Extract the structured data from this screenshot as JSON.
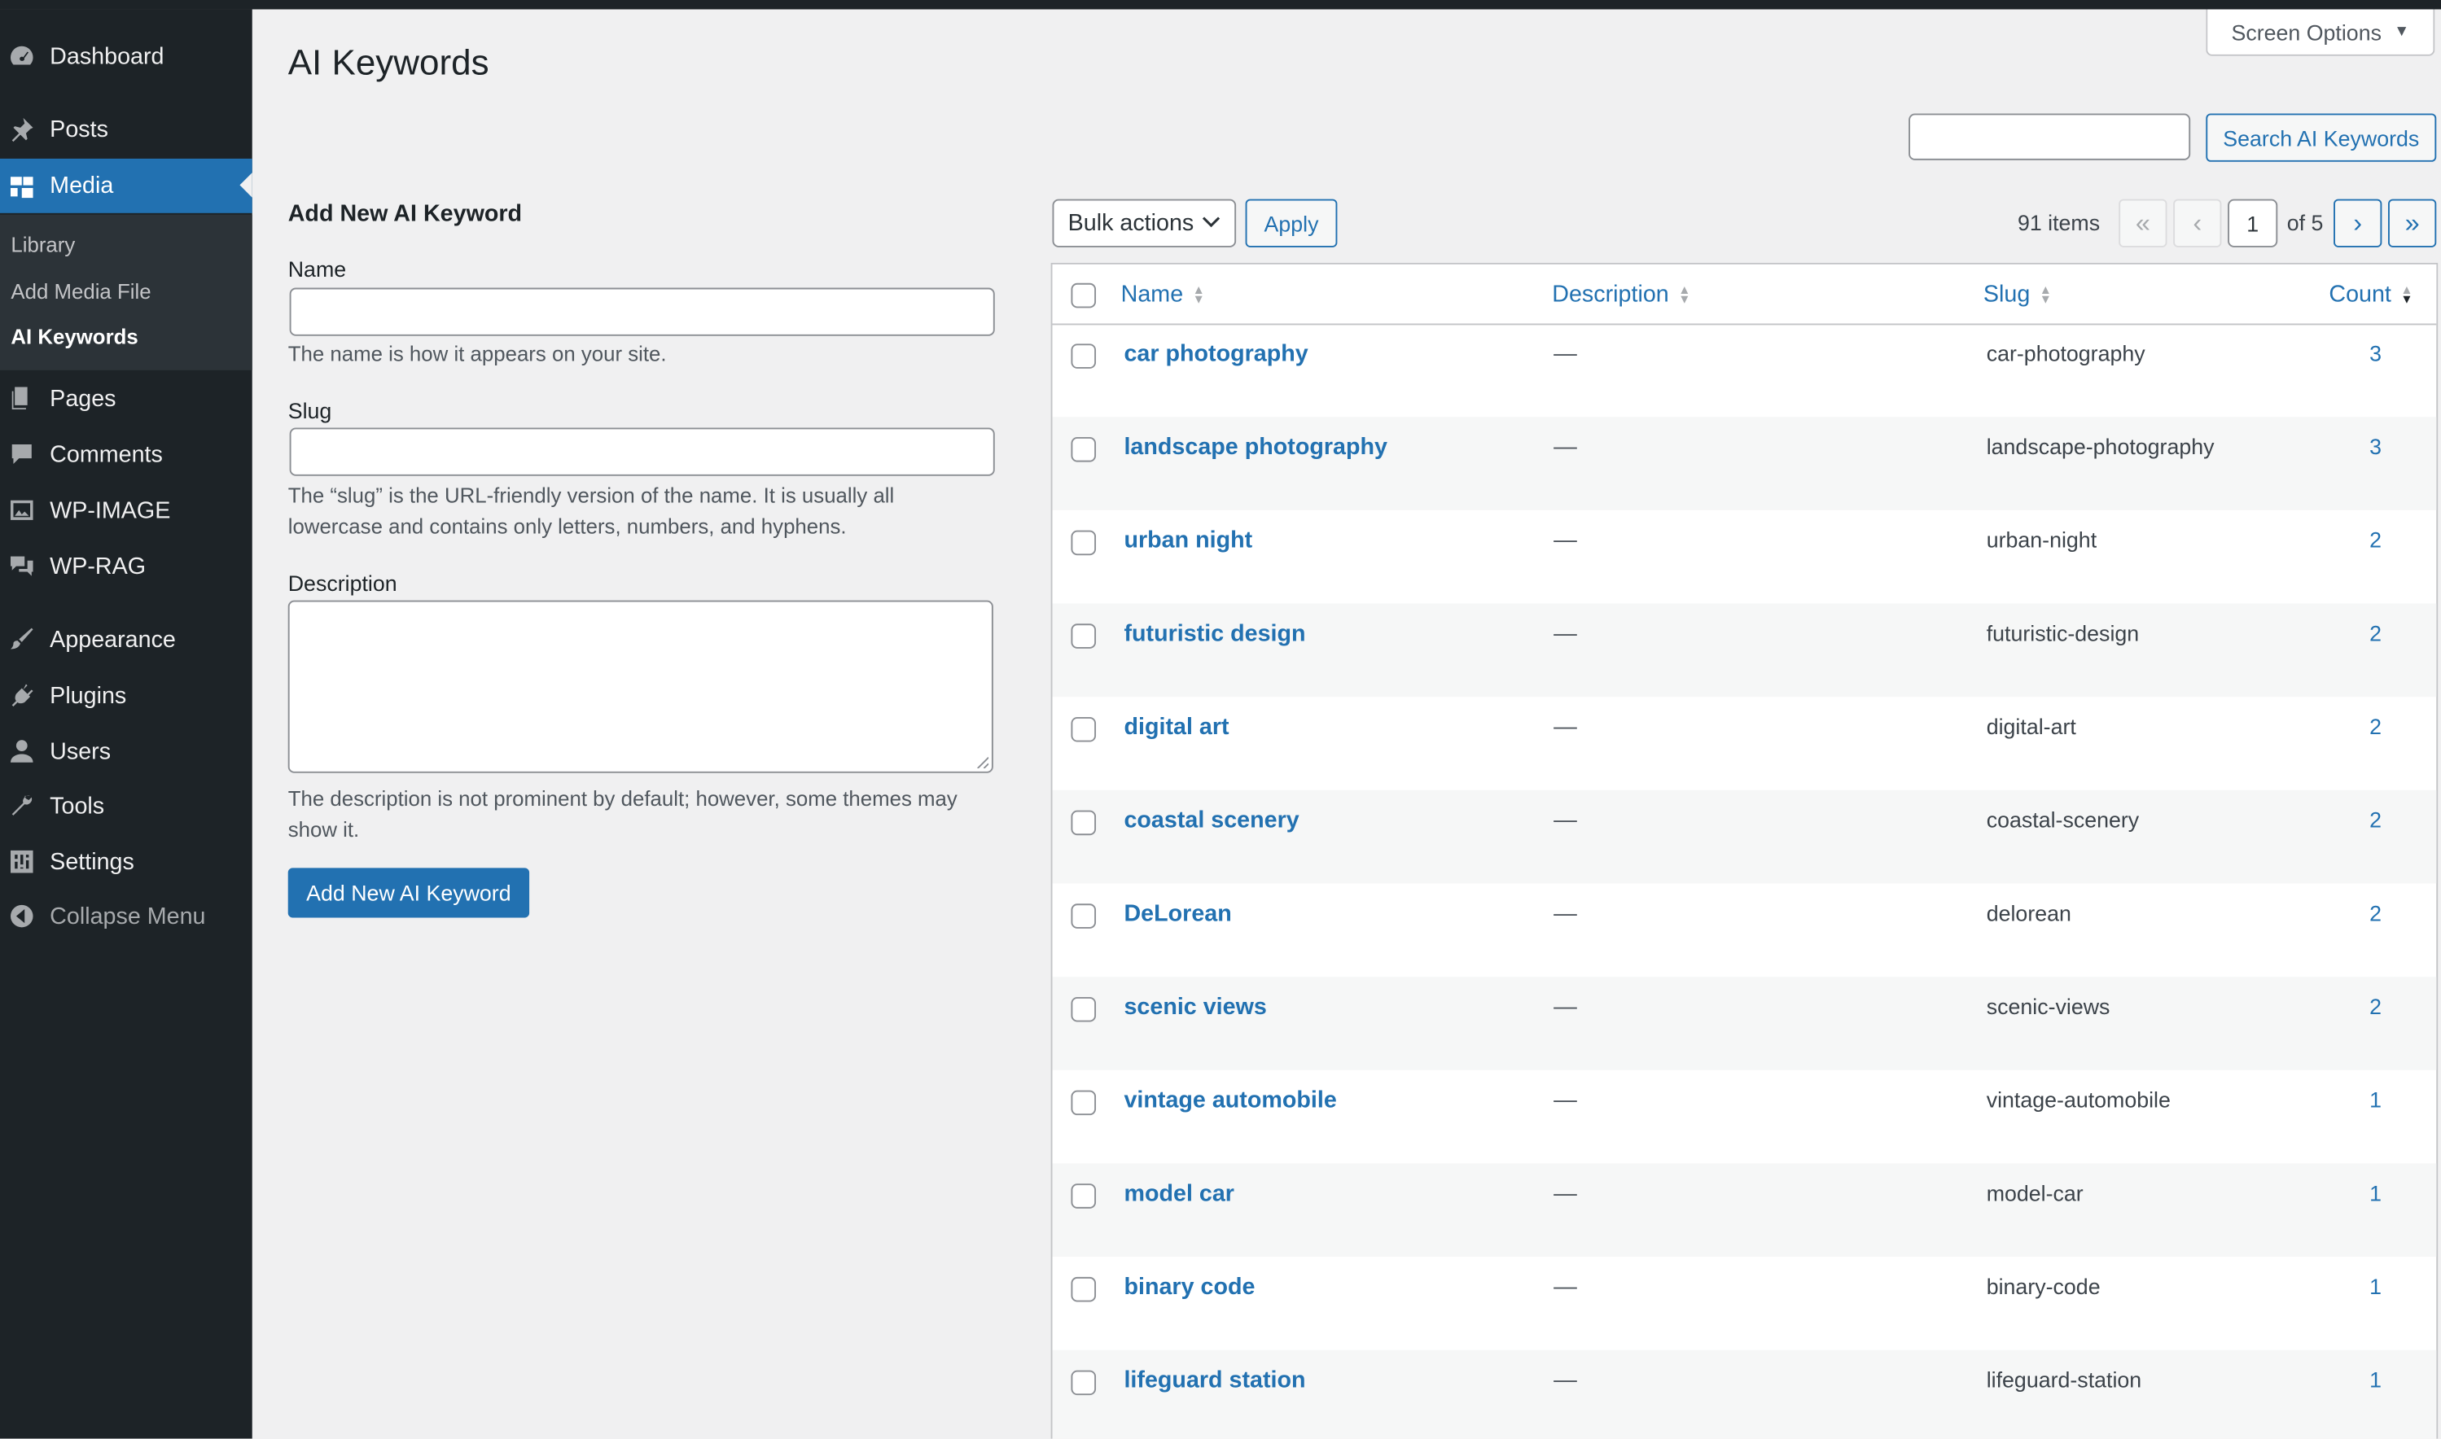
{
  "sidebar": {
    "items": [
      {
        "label": "Dashboard",
        "icon": "dashboard-icon"
      },
      {
        "label": "Posts",
        "icon": "pin-icon"
      },
      {
        "label": "Media",
        "icon": "media-icon"
      },
      {
        "label": "Pages",
        "icon": "pages-icon"
      },
      {
        "label": "Comments",
        "icon": "comments-icon"
      },
      {
        "label": "WP-IMAGE",
        "icon": "image-icon"
      },
      {
        "label": "WP-RAG",
        "icon": "chat-icon"
      },
      {
        "label": "Appearance",
        "icon": "brush-icon"
      },
      {
        "label": "Plugins",
        "icon": "plugin-icon"
      },
      {
        "label": "Users",
        "icon": "user-icon"
      },
      {
        "label": "Tools",
        "icon": "wrench-icon"
      },
      {
        "label": "Settings",
        "icon": "settings-icon"
      }
    ],
    "submenu": [
      "Library",
      "Add Media File",
      "AI Keywords"
    ],
    "collapse_label": "Collapse Menu"
  },
  "header": {
    "title": "AI Keywords",
    "screen_options": "Screen Options"
  },
  "search": {
    "value": "",
    "button_label": "Search AI Keywords"
  },
  "form": {
    "title": "Add New AI Keyword",
    "name_label": "Name",
    "name_value": "",
    "name_help": "The name is how it appears on your site.",
    "slug_label": "Slug",
    "slug_value": "",
    "slug_help": "The “slug” is the URL-friendly version of the name. It is usually all lowercase and contains only letters, numbers, and hyphens.",
    "description_label": "Description",
    "description_value": "",
    "description_help": "The description is not prominent by default; however, some themes may show it.",
    "submit_label": "Add New AI Keyword"
  },
  "table_controls": {
    "bulk_actions": "Bulk actions",
    "apply": "Apply",
    "items_count": "91 items",
    "first": "«",
    "prev": "‹",
    "current_page": "1",
    "of_pages": "of 5",
    "next": "›",
    "last": "»"
  },
  "table": {
    "columns": [
      "Name",
      "Description",
      "Slug",
      "Count"
    ],
    "rows": [
      {
        "name": "car photography",
        "description": "—",
        "slug": "car-photography",
        "count": "3"
      },
      {
        "name": "landscape photography",
        "description": "—",
        "slug": "landscape-photography",
        "count": "3"
      },
      {
        "name": "urban night",
        "description": "—",
        "slug": "urban-night",
        "count": "2"
      },
      {
        "name": "futuristic design",
        "description": "—",
        "slug": "futuristic-design",
        "count": "2"
      },
      {
        "name": "digital art",
        "description": "—",
        "slug": "digital-art",
        "count": "2"
      },
      {
        "name": "coastal scenery",
        "description": "—",
        "slug": "coastal-scenery",
        "count": "2"
      },
      {
        "name": "DeLorean",
        "description": "—",
        "slug": "delorean",
        "count": "2"
      },
      {
        "name": "scenic views",
        "description": "—",
        "slug": "scenic-views",
        "count": "2"
      },
      {
        "name": "vintage automobile",
        "description": "—",
        "slug": "vintage-automobile",
        "count": "1"
      },
      {
        "name": "model car",
        "description": "—",
        "slug": "model-car",
        "count": "1"
      },
      {
        "name": "binary code",
        "description": "—",
        "slug": "binary-code",
        "count": "1"
      },
      {
        "name": "lifeguard station",
        "description": "—",
        "slug": "lifeguard-station",
        "count": "1"
      }
    ]
  },
  "colors": {
    "accent": "#2271b1",
    "sidebar_bg": "#1d2327",
    "page_bg": "#f0f0f1"
  }
}
